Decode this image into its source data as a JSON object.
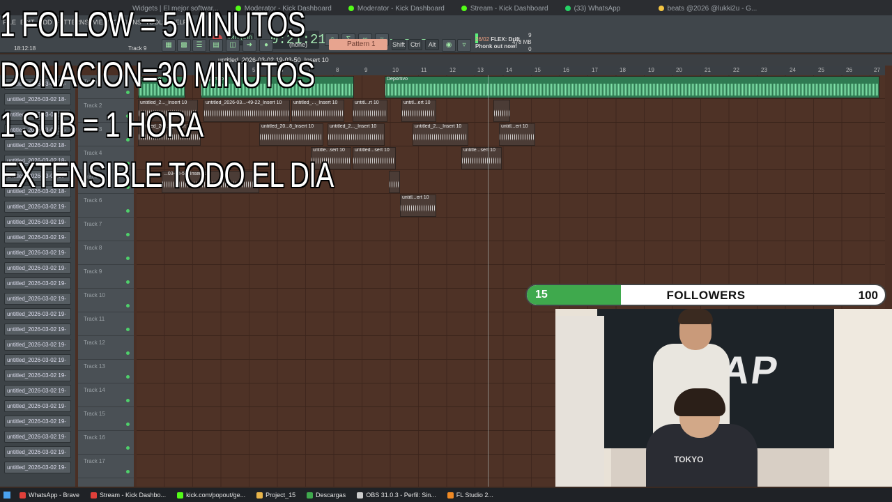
{
  "browser_tabs": [
    {
      "label": "Widgets | El mejor softwar..."
    },
    {
      "label": "Moderator - Kick Dashboard"
    },
    {
      "label": "Moderator - Kick Dashboard"
    },
    {
      "label": "Stream - Kick Dashboard"
    },
    {
      "label": "(33) WhatsApp"
    },
    {
      "label": "beats @2026 @lukki2u - G..."
    }
  ],
  "fl": {
    "menu": [
      "FILE",
      "EDIT",
      "ADD",
      "PATTERNS",
      "VIEW",
      "OPTIONS",
      "TOOLS",
      "HELP"
    ],
    "tempo": "140.000",
    "time": "0:21:21",
    "cpu_value": "9",
    "ram_value": "478 MB",
    "voices": "0",
    "clock": "18:12:18",
    "track_label": "Track 9",
    "snap": "(none)",
    "pattern": "Pattern 1",
    "mod_shift": "Shift",
    "mod_ctrl": "Ctrl",
    "mod_alt": "Alt",
    "news_date": "26/02",
    "news_text": "FLEX: Drift Phonk out now!",
    "playlist_title": "untitled_2026-03-02 19-03-50_Insert 10",
    "ruler": [
      "3",
      "5",
      "6",
      "7",
      "8",
      "9",
      "10",
      "11",
      "12",
      "13",
      "14",
      "15",
      "16",
      "17",
      "18",
      "19",
      "20",
      "21",
      "22",
      "23",
      "24",
      "25",
      "26",
      "27"
    ]
  },
  "browser_items": [
    "untitled_2026-03-02 18-",
    "untitled_2026-03-02 18-",
    "untitled_2026-03-02 18-",
    "untitled_2026-03-02 18-",
    "untitled_2026-03-02 18-",
    "untitled_2026-03-02 18-",
    "untitled_2026-03-02 18-",
    "untitled_2026-03-02 18-",
    "untitled_2026-03-02 19-",
    "untitled_2026-03-02 19-",
    "untitled_2026-03-02 19-",
    "untitled_2026-03-02 19-",
    "untitled_2026-03-02 19-",
    "untitled_2026-03-02 19-",
    "untitled_2026-03-02 19-",
    "untitled_2026-03-02 19-",
    "untitled_2026-03-02 19-",
    "untitled_2026-03-02 19-",
    "untitled_2026-03-02 19-",
    "untitled_2026-03-02 19-",
    "untitled_2026-03-02 19-",
    "untitled_2026-03-02 19-",
    "untitled_2026-03-02 19-",
    "untitled_2026-03-02 19-",
    "untitled_2026-03-02 19-",
    "untitled_2026-03-02 19-"
  ],
  "tracks": [
    "Track 1",
    "Track 2",
    "Track 3",
    "Track 4",
    "Track 5",
    "Track 6",
    "Track 7",
    "Track 8",
    "Track 9",
    "Track 10",
    "Track 11",
    "Track 12",
    "Track 13",
    "Track 14",
    "Track 15",
    "Track 16",
    "Track 17"
  ],
  "clips": {
    "deportivo": "Deportivo",
    "c1": "untitled_2..._Insert 10",
    "c2": "untitled_2026-03...-49-22_Insert 10",
    "c3": "untitled_..._Insert 10",
    "c4": "untitl...rt 10",
    "c5": "untitl...ert 10",
    "c6": "untitled_20...2_Insert 10",
    "c7": "untitled_20...8_Insert 10",
    "c8": "untitled_2..._Insert 10",
    "c9": "untitled_2..._Insert 10",
    "c10": "untitl...ert 10",
    "c11": "untitle...sert 10",
    "c12": "untitled...sert 10",
    "c13": "untitle...sert 10",
    "c14": "...03-48-59_Insert 10",
    "c15": "untitl...ert 10"
  },
  "overlay": {
    "line1": "1 FOLLOW = 5 MINUTOS",
    "line2": "DONACION=30 MINUTOS",
    "line3": "1 SUB = 1 HORA",
    "line4": "EXTENSIBLE TODO EL DIA"
  },
  "followers": {
    "current": "15",
    "label": "FOLLOWERS",
    "goal": "100",
    "progress": 0.15,
    "fill_color": "#3fa94d"
  },
  "webcam": {
    "flag_text": "TRAP",
    "shirt_text": "TOKYO"
  },
  "taskbar": [
    {
      "label": "WhatsApp - Brave",
      "color": "#e0403a"
    },
    {
      "label": "Stream - Kick Dashbo...",
      "color": "#e0403a"
    },
    {
      "label": "kick.com/popout/ge...",
      "color": "#53fc18"
    },
    {
      "label": "Project_15",
      "color": "#e8b54a"
    },
    {
      "label": "Descargas",
      "color": "#3fa94d"
    },
    {
      "label": "OBS 31.0.3 - Perfil: Sin...",
      "color": "#cccccc"
    },
    {
      "label": "FL Studio 2...",
      "color": "#f08a24"
    }
  ]
}
